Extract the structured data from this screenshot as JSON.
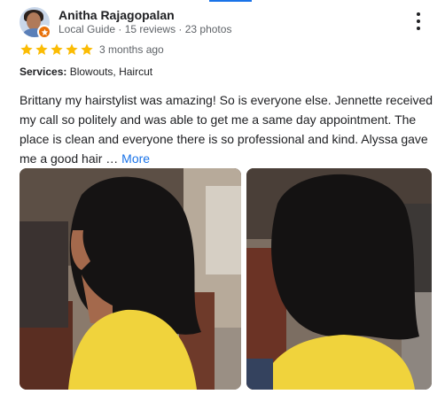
{
  "reviewer": {
    "name": "Anitha Rajagopalan",
    "meta": "Local Guide · 15 reviews · 23 photos",
    "avatar_icon": "avatar-photo",
    "badge_icon": "local-guide-star-icon"
  },
  "rating": {
    "stars": 5,
    "max": 5,
    "star_color": "#fbbc04"
  },
  "posted": "3 months ago",
  "services": {
    "label": "Services:",
    "value": " Blowouts, Haircut"
  },
  "review": {
    "lines": [
      "Brittany my hairstylist was amazing! So is everyone else. Jennette received",
      "my call so politely and was able to get me a same day appointment. The",
      "place is clean and everyone there is so professional and kind. Alyssa gave",
      "me a good hair … "
    ],
    "more_label": "More"
  },
  "colors": {
    "link": "#1a73e8",
    "tab_indicator": "#1a73e8",
    "badge": "#e8710a"
  },
  "menu_icon": "more-vert-icon"
}
